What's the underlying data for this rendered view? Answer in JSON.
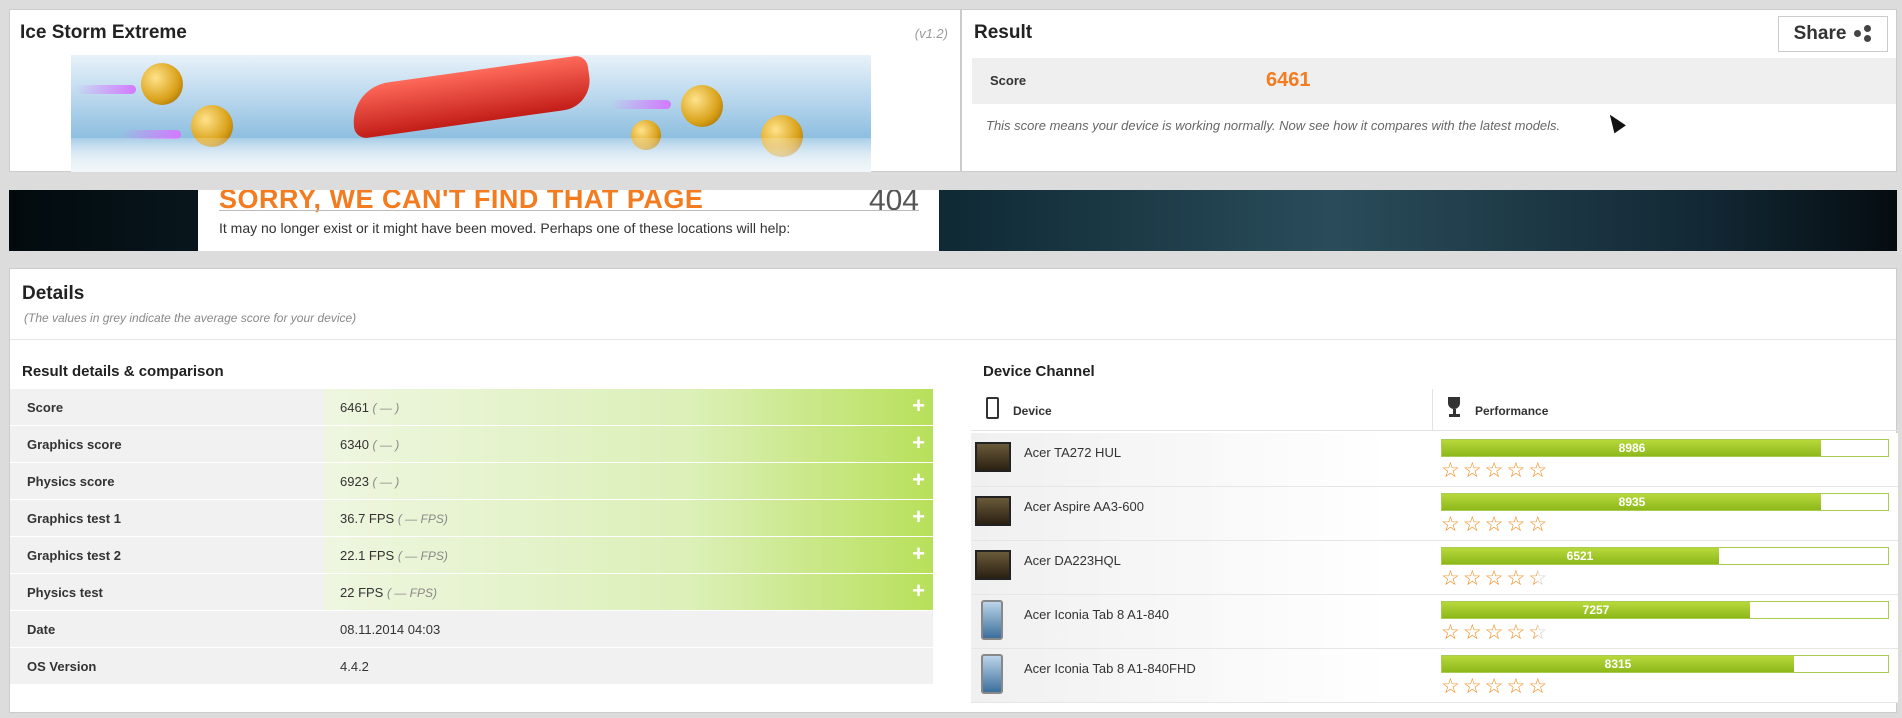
{
  "test": {
    "title": "Ice Storm Extreme",
    "version": "(v1.2)"
  },
  "result": {
    "title": "Result",
    "share_label": "Share",
    "score_label": "Score",
    "score_value": "6461",
    "note": "This score means your device is working normally. Now see how it compares with the latest models."
  },
  "error404": {
    "heading": "SORRY, WE CAN'T FIND THAT PAGE",
    "code": "404",
    "message": "It may no longer exist or it might have been moved. Perhaps one of these locations will help:"
  },
  "details": {
    "title": "Details",
    "subtitle": "(The values in grey indicate the average score for your device)",
    "comparison_title": "Result details & comparison",
    "rows": [
      {
        "label": "Score",
        "value": "6461",
        "avg": "( — )"
      },
      {
        "label": "Graphics score",
        "value": "6340",
        "avg": "( — )"
      },
      {
        "label": "Physics score",
        "value": "6923",
        "avg": "( — )"
      },
      {
        "label": "Graphics test 1",
        "value": "36.7 FPS",
        "avg": "( — FPS)"
      },
      {
        "label": "Graphics test 2",
        "value": "22.1 FPS",
        "avg": "( — FPS)"
      },
      {
        "label": "Physics test",
        "value": "22 FPS",
        "avg": "( — FPS)"
      },
      {
        "label": "Date",
        "value": "08.11.2014 04:03",
        "avg": ""
      },
      {
        "label": "OS Version",
        "value": "4.4.2",
        "avg": ""
      }
    ],
    "expand_symbol": "+"
  },
  "device_channel": {
    "title": "Device Channel",
    "col_device": "Device",
    "col_performance": "Performance",
    "devices": [
      {
        "name": "Acer TA272 HUL",
        "score": "8986",
        "fill": 0.85,
        "rating": 5,
        "thumb": "monitor"
      },
      {
        "name": "Acer Aspire AA3-600",
        "score": "8935",
        "fill": 0.85,
        "rating": 5,
        "thumb": "monitor"
      },
      {
        "name": "Acer DA223HQL",
        "score": "6521",
        "fill": 0.62,
        "rating": 4.5,
        "thumb": "monitor"
      },
      {
        "name": "Acer Iconia Tab 8 A1-840",
        "score": "7257",
        "fill": 0.69,
        "rating": 4.5,
        "thumb": "tablet"
      },
      {
        "name": "Acer Iconia Tab 8 A1-840FHD",
        "score": "8315",
        "fill": 0.79,
        "rating": 5,
        "thumb": "tablet"
      }
    ]
  },
  "colors": {
    "accent": "#f47c20",
    "bar": "#9cc42a",
    "star": "#f28b1d"
  },
  "icons": [
    "share-icon",
    "phone-icon",
    "trophy-icon",
    "plus-icon",
    "star-icon"
  ]
}
